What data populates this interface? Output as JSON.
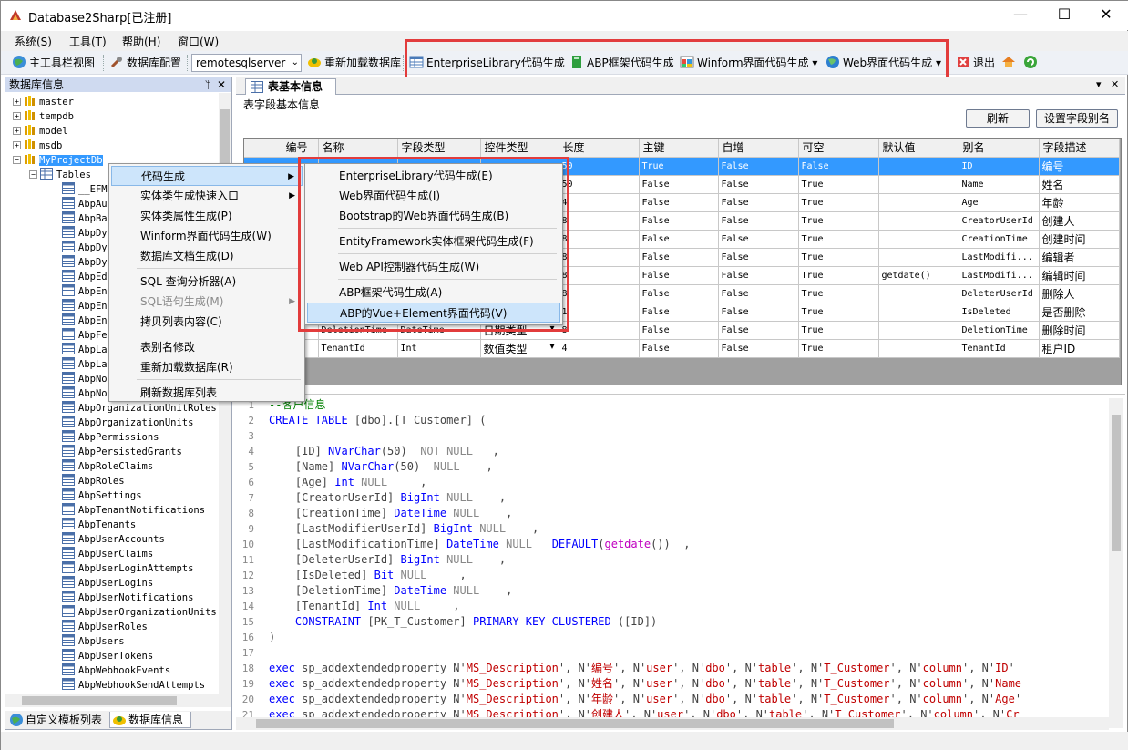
{
  "window": {
    "title": "Database2Sharp[已注册]",
    "minimize": "—",
    "maximize": "☐",
    "close": "✕"
  },
  "menu": [
    "系统(S)",
    "工具(T)",
    "帮助(H)",
    "窗口(W)"
  ],
  "toolbar": {
    "main_toolbar_view": "主工具栏视图",
    "db_config": "数据库配置",
    "server": "remotesqlserver",
    "reload_db": "重新加载数据库",
    "enterprise_lib": "EnterpriseLibrary代码生成",
    "abp_framework": "ABP框架代码生成",
    "winform": "Winform界面代码生成",
    "web": "Web界面代码生成",
    "exit": "退出"
  },
  "left_panel": {
    "title": "数据库信息",
    "pin": "ᛘ",
    "close": "✕",
    "databases": [
      "master",
      "tempdb",
      "model",
      "msdb",
      "MyProjectDb"
    ],
    "tables_node": "Tables",
    "tables_partial": [
      "__EFM",
      "AbpAu",
      "AbpBa",
      "AbpDy",
      "AbpDy",
      "AbpDy",
      "AbpEd",
      "AbpEn",
      "AbpEn",
      "AbpEn",
      "AbpFe",
      "AbpLa",
      "AbpLa",
      "AbpNo",
      "AbpNo"
    ],
    "tables": [
      "AbpOrganizationUnitRoles",
      "AbpOrganizationUnits",
      "AbpPermissions",
      "AbpPersistedGrants",
      "AbpRoleClaims",
      "AbpRoles",
      "AbpSettings",
      "AbpTenantNotifications",
      "AbpTenants",
      "AbpUserAccounts",
      "AbpUserClaims",
      "AbpUserLoginAttempts",
      "AbpUserLogins",
      "AbpUserNotifications",
      "AbpUserOrganizationUnits",
      "AbpUserRoles",
      "AbpUsers",
      "AbpUserTokens",
      "AbpWebhookEvents",
      "AbpWebhookSendAttempts"
    ],
    "tabs": [
      "自定义模板列表",
      "数据库信息"
    ]
  },
  "doc": {
    "tab": "表基本信息",
    "section": "表字段基本信息",
    "refresh": "刷新",
    "set_alias": "设置字段别名",
    "columns": [
      "编号",
      "名称",
      "字段类型",
      "控件类型",
      "长度",
      "主键",
      "自增",
      "可空",
      "默认值",
      "别名",
      "字段描述"
    ],
    "rows": [
      [
        "",
        "",
        "",
        "",
        "50",
        "True",
        "False",
        "False",
        "",
        "ID",
        "编号"
      ],
      [
        "",
        "",
        "",
        "",
        "50",
        "False",
        "False",
        "True",
        "",
        "Name",
        "姓名"
      ],
      [
        "",
        "",
        "",
        "",
        "4",
        "False",
        "False",
        "True",
        "",
        "Age",
        "年龄"
      ],
      [
        "",
        "",
        "",
        "",
        "8",
        "False",
        "False",
        "True",
        "",
        "CreatorUserId",
        "创建人"
      ],
      [
        "",
        "",
        "",
        "",
        "8",
        "False",
        "False",
        "True",
        "",
        "CreationTime",
        "创建时间"
      ],
      [
        "",
        "",
        "",
        "",
        "8",
        "False",
        "False",
        "True",
        "",
        "LastModifi...",
        "编辑者"
      ],
      [
        "",
        "",
        "",
        "",
        "8",
        "False",
        "False",
        "True",
        "getdate()",
        "LastModifi...",
        "编辑时间"
      ],
      [
        "",
        "",
        "",
        "",
        "8",
        "False",
        "False",
        "True",
        "",
        "DeleterUserId",
        "删除人"
      ],
      [
        "",
        "",
        "",
        "",
        "1",
        "False",
        "False",
        "True",
        "",
        "IsDeleted",
        "是否删除"
      ],
      [
        "",
        "DeletionTime",
        "DateTime",
        "日期类型",
        "8",
        "False",
        "False",
        "True",
        "",
        "DeletionTime",
        "删除时间"
      ],
      [
        "",
        "TenantId",
        "Int",
        "数值类型",
        "4",
        "False",
        "False",
        "True",
        "",
        "TenantId",
        "租户ID"
      ]
    ]
  },
  "code": [
    [
      [
        "--客户信息",
        "#008000"
      ]
    ],
    [
      [
        "CREATE TABLE",
        "#0000ff"
      ],
      [
        " [dbo].[T_Customer] (",
        "#444444"
      ]
    ],
    [
      [
        "",
        "#000"
      ]
    ],
    [
      [
        "    [ID] ",
        "#444444"
      ],
      [
        "NVarChar",
        "#0000ff"
      ],
      [
        "(50)  ",
        "#444444"
      ],
      [
        "NOT NULL",
        "#888888"
      ],
      [
        "   ,",
        "#444444"
      ]
    ],
    [
      [
        "    [Name] ",
        "#444444"
      ],
      [
        "NVarChar",
        "#0000ff"
      ],
      [
        "(50)  ",
        "#444444"
      ],
      [
        "NULL",
        "#888888"
      ],
      [
        "    ,",
        "#444444"
      ]
    ],
    [
      [
        "    [Age] ",
        "#444444"
      ],
      [
        "Int",
        "#0000ff"
      ],
      [
        " NULL",
        "#888888"
      ],
      [
        "     ,",
        "#444444"
      ]
    ],
    [
      [
        "    [CreatorUserId] ",
        "#444444"
      ],
      [
        "BigInt",
        "#0000ff"
      ],
      [
        " NULL",
        "#888888"
      ],
      [
        "    ,",
        "#444444"
      ]
    ],
    [
      [
        "    [CreationTime] ",
        "#444444"
      ],
      [
        "DateTime",
        "#0000ff"
      ],
      [
        " NULL",
        "#888888"
      ],
      [
        "    ,",
        "#444444"
      ]
    ],
    [
      [
        "    [LastModifierUserId] ",
        "#444444"
      ],
      [
        "BigInt",
        "#0000ff"
      ],
      [
        " NULL",
        "#888888"
      ],
      [
        "    ,",
        "#444444"
      ]
    ],
    [
      [
        "    [LastModificationTime] ",
        "#444444"
      ],
      [
        "DateTime",
        "#0000ff"
      ],
      [
        " NULL",
        "#888888"
      ],
      [
        "   ",
        "#444444"
      ],
      [
        "DEFAULT",
        "#0000ff"
      ],
      [
        "(",
        "#444444"
      ],
      [
        "getdate",
        "#c000c0"
      ],
      [
        "())  ,",
        "#444444"
      ]
    ],
    [
      [
        "    [DeleterUserId] ",
        "#444444"
      ],
      [
        "BigInt",
        "#0000ff"
      ],
      [
        " NULL",
        "#888888"
      ],
      [
        "    ,",
        "#444444"
      ]
    ],
    [
      [
        "    [IsDeleted] ",
        "#444444"
      ],
      [
        "Bit",
        "#0000ff"
      ],
      [
        " NULL",
        "#888888"
      ],
      [
        "     ,",
        "#444444"
      ]
    ],
    [
      [
        "    [DeletionTime] ",
        "#444444"
      ],
      [
        "DateTime",
        "#0000ff"
      ],
      [
        " NULL",
        "#888888"
      ],
      [
        "    ,",
        "#444444"
      ]
    ],
    [
      [
        "    [TenantId] ",
        "#444444"
      ],
      [
        "Int",
        "#0000ff"
      ],
      [
        " NULL",
        "#888888"
      ],
      [
        "     ,",
        "#444444"
      ]
    ],
    [
      [
        "    ",
        "#444444"
      ],
      [
        "CONSTRAINT",
        "#0000ff"
      ],
      [
        " [PK_T_Customer] ",
        "#444444"
      ],
      [
        "PRIMARY KEY CLUSTERED",
        "#0000ff"
      ],
      [
        " ([ID])",
        "#444444"
      ]
    ],
    [
      [
        ")",
        "#444444"
      ]
    ],
    [
      [
        "",
        "#000"
      ]
    ],
    [
      [
        "exec",
        "#0000ff"
      ],
      [
        " sp_addextendedproperty N'",
        "#444444"
      ],
      [
        "MS_Description",
        "#c00000"
      ],
      [
        "', N'",
        "#444444"
      ],
      [
        "编号",
        "#c00000"
      ],
      [
        "', N'",
        "#444444"
      ],
      [
        "user",
        "#c00000"
      ],
      [
        "', N'",
        "#444444"
      ],
      [
        "dbo",
        "#c00000"
      ],
      [
        "', N'",
        "#444444"
      ],
      [
        "table",
        "#c00000"
      ],
      [
        "', N'",
        "#444444"
      ],
      [
        "T_Customer",
        "#c00000"
      ],
      [
        "', N'",
        "#444444"
      ],
      [
        "column",
        "#c00000"
      ],
      [
        "', N'",
        "#444444"
      ],
      [
        "ID",
        "#c00000"
      ],
      [
        "'",
        "#444444"
      ]
    ],
    [
      [
        "exec",
        "#0000ff"
      ],
      [
        " sp_addextendedproperty N'",
        "#444444"
      ],
      [
        "MS_Description",
        "#c00000"
      ],
      [
        "', N'",
        "#444444"
      ],
      [
        "姓名",
        "#c00000"
      ],
      [
        "', N'",
        "#444444"
      ],
      [
        "user",
        "#c00000"
      ],
      [
        "', N'",
        "#444444"
      ],
      [
        "dbo",
        "#c00000"
      ],
      [
        "', N'",
        "#444444"
      ],
      [
        "table",
        "#c00000"
      ],
      [
        "', N'",
        "#444444"
      ],
      [
        "T_Customer",
        "#c00000"
      ],
      [
        "', N'",
        "#444444"
      ],
      [
        "column",
        "#c00000"
      ],
      [
        "', N'",
        "#444444"
      ],
      [
        "Name",
        "#c00000"
      ]
    ],
    [
      [
        "exec",
        "#0000ff"
      ],
      [
        " sp_addextendedproperty N'",
        "#444444"
      ],
      [
        "MS_Description",
        "#c00000"
      ],
      [
        "', N'",
        "#444444"
      ],
      [
        "年龄",
        "#c00000"
      ],
      [
        "', N'",
        "#444444"
      ],
      [
        "user",
        "#c00000"
      ],
      [
        "', N'",
        "#444444"
      ],
      [
        "dbo",
        "#c00000"
      ],
      [
        "', N'",
        "#444444"
      ],
      [
        "table",
        "#c00000"
      ],
      [
        "', N'",
        "#444444"
      ],
      [
        "T_Customer",
        "#c00000"
      ],
      [
        "', N'",
        "#444444"
      ],
      [
        "column",
        "#c00000"
      ],
      [
        "', N'",
        "#444444"
      ],
      [
        "Age",
        "#c00000"
      ],
      [
        "'",
        "#444444"
      ]
    ],
    [
      [
        "exec",
        "#0000ff"
      ],
      [
        " sp_addextendedproperty N'",
        "#444444"
      ],
      [
        "MS_Description",
        "#c00000"
      ],
      [
        "', N'",
        "#444444"
      ],
      [
        "创建人",
        "#c00000"
      ],
      [
        "', N'",
        "#444444"
      ],
      [
        "user",
        "#c00000"
      ],
      [
        "', N'",
        "#444444"
      ],
      [
        "dbo",
        "#c00000"
      ],
      [
        "', N'",
        "#444444"
      ],
      [
        "table",
        "#c00000"
      ],
      [
        "', N'",
        "#444444"
      ],
      [
        "T_Customer",
        "#c00000"
      ],
      [
        "', N'",
        "#444444"
      ],
      [
        "column",
        "#c00000"
      ],
      [
        "', N'",
        "#444444"
      ],
      [
        "Cr",
        "#c00000"
      ]
    ]
  ],
  "context_menu": [
    {
      "label": "代码生成",
      "sub": true,
      "hl": true
    },
    {
      "label": "实体类生成快速入口",
      "sub": true
    },
    {
      "label": "实体类属性生成(P)"
    },
    {
      "label": "Winform界面代码生成(W)"
    },
    {
      "label": "数据库文档生成(D)"
    },
    {
      "sep": true
    },
    {
      "label": "SQL 查询分析器(A)"
    },
    {
      "label": "SQL语句生成(M)",
      "sub": true,
      "dis": true
    },
    {
      "label": "拷贝列表内容(C)"
    },
    {
      "sep": true
    },
    {
      "label": "表别名修改"
    },
    {
      "label": "重新加载数据库(R)"
    },
    {
      "sep": true
    },
    {
      "label": "刷新数据库列表"
    }
  ],
  "submenu": [
    {
      "label": "EnterpriseLibrary代码生成(E)"
    },
    {
      "label": "Web界面代码生成(I)"
    },
    {
      "label": "Bootstrap的Web界面代码生成(B)"
    },
    {
      "sep": true
    },
    {
      "label": "EntityFramework实体框架代码生成(F)"
    },
    {
      "sep": true
    },
    {
      "label": "Web API控制器代码生成(W)"
    },
    {
      "sep": true
    },
    {
      "label": "ABP框架代码生成(A)"
    },
    {
      "label": "ABP的Vue+Element界面代码(V)",
      "hl": true
    }
  ],
  "colors": {
    "highlight_box": "#e23c3c",
    "selection": "#3399ff",
    "menu_hover": "#cde5fb"
  }
}
